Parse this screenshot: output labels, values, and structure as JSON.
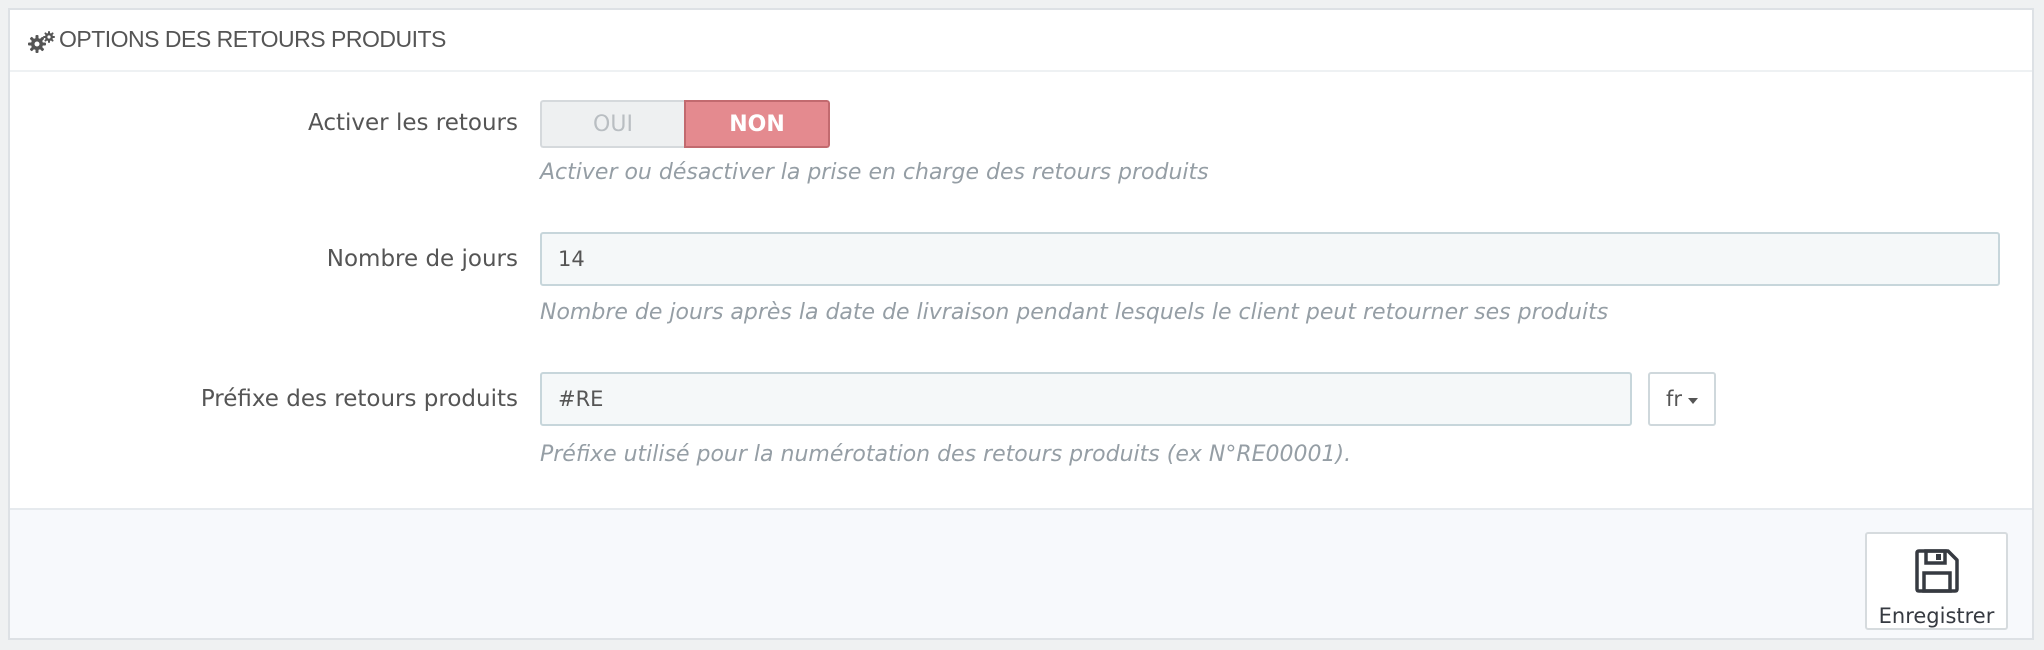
{
  "panel": {
    "title": "OPTIONS DES RETOURS PRODUITS",
    "icon": "gears-icon"
  },
  "fields": {
    "returns_enabled": {
      "label": "Activer les retours",
      "option_yes": "OUI",
      "option_no": "NON",
      "selected": "NON",
      "help": "Activer ou désactiver la prise en charge des retours produits"
    },
    "days": {
      "label": "Nombre de jours",
      "value": "14",
      "help": "Nombre de jours après la date de livraison pendant lesquels le client peut retourner ses produits"
    },
    "prefix": {
      "label": "Préfixe des retours produits",
      "value": "#RE",
      "language": "fr",
      "help": "Préfixe utilisé pour la numérotation des retours produits (ex N°RE00001)."
    }
  },
  "footer": {
    "save_label": "Enregistrer",
    "save_icon": "save-icon"
  },
  "colors": {
    "switch_active": "#e48a8f",
    "help_text": "#959ea5",
    "input_border": "#c7d6db"
  }
}
